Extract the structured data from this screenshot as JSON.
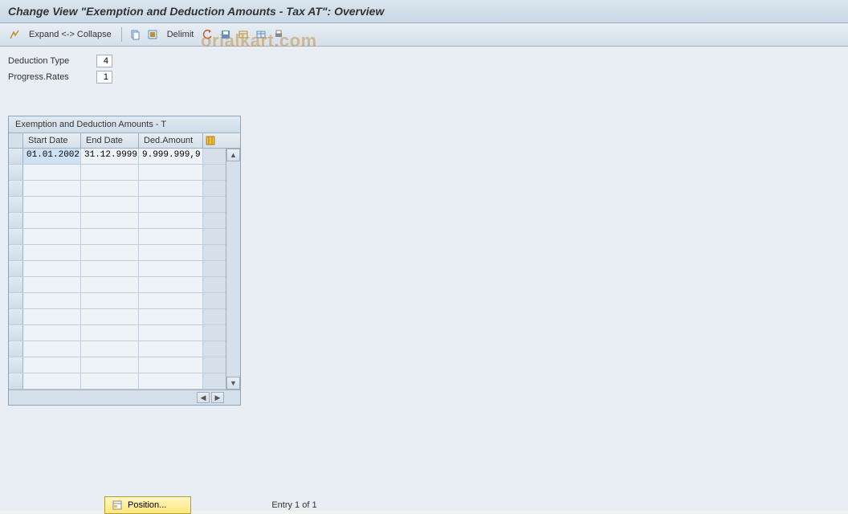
{
  "header": {
    "title": "Change View \"Exemption and Deduction Amounts - Tax AT\": Overview"
  },
  "toolbar": {
    "expand_collapse": "Expand <-> Collapse",
    "delimit": "Delimit"
  },
  "fields": {
    "deduction_type_label": "Deduction Type",
    "deduction_type_value": "4",
    "progress_rates_label": "Progress.Rates",
    "progress_rates_value": "1"
  },
  "panel": {
    "title": "Exemption and Deduction Amounts - T",
    "columns": {
      "start_date": "Start Date",
      "end_date": "End Date",
      "ded_amount": "Ded.Amount"
    },
    "rows": [
      {
        "start": "01.01.2002",
        "end": "31.12.9999",
        "amount": "9.999.999,9"
      }
    ],
    "empty_row_count": 14
  },
  "footer": {
    "position_label": "Position...",
    "entry_text": "Entry 1 of 1"
  },
  "watermark": "orialkart.com"
}
